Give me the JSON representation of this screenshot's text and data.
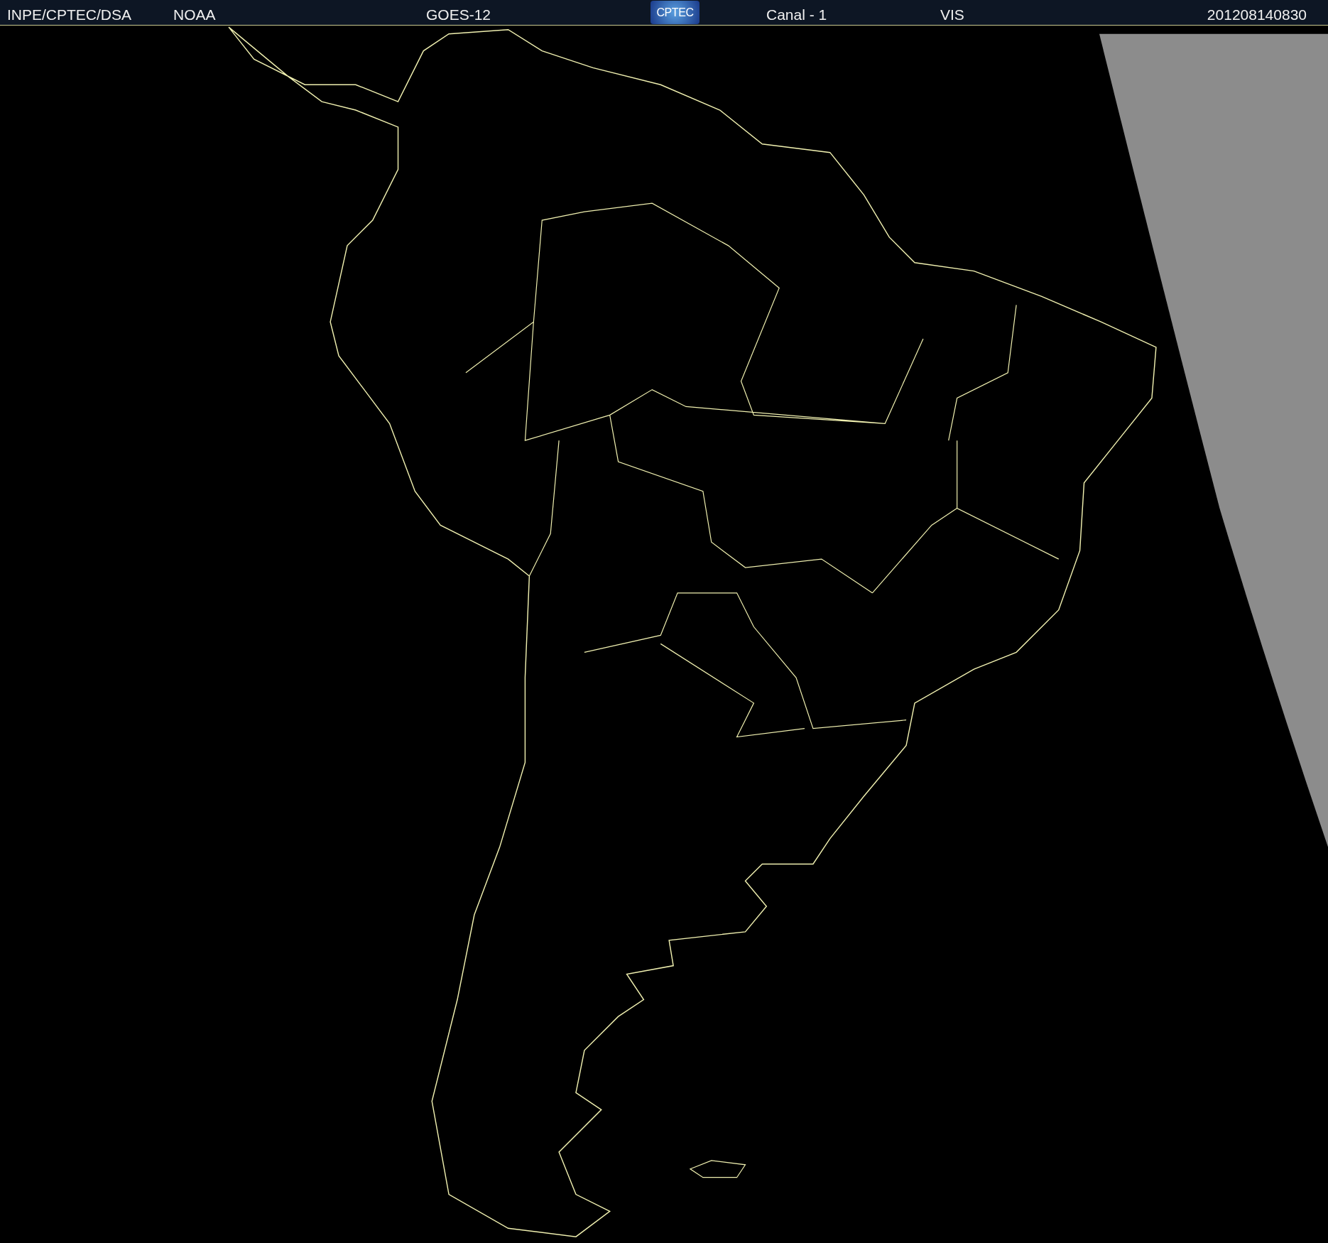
{
  "header": {
    "left": [
      "INPE/CPTEC/DSA",
      "NOAA"
    ],
    "satellite": "GOES-12",
    "logo": "CPTEC",
    "channel": "Canal - 1",
    "band": "VIS",
    "timestamp": "201208140830"
  }
}
